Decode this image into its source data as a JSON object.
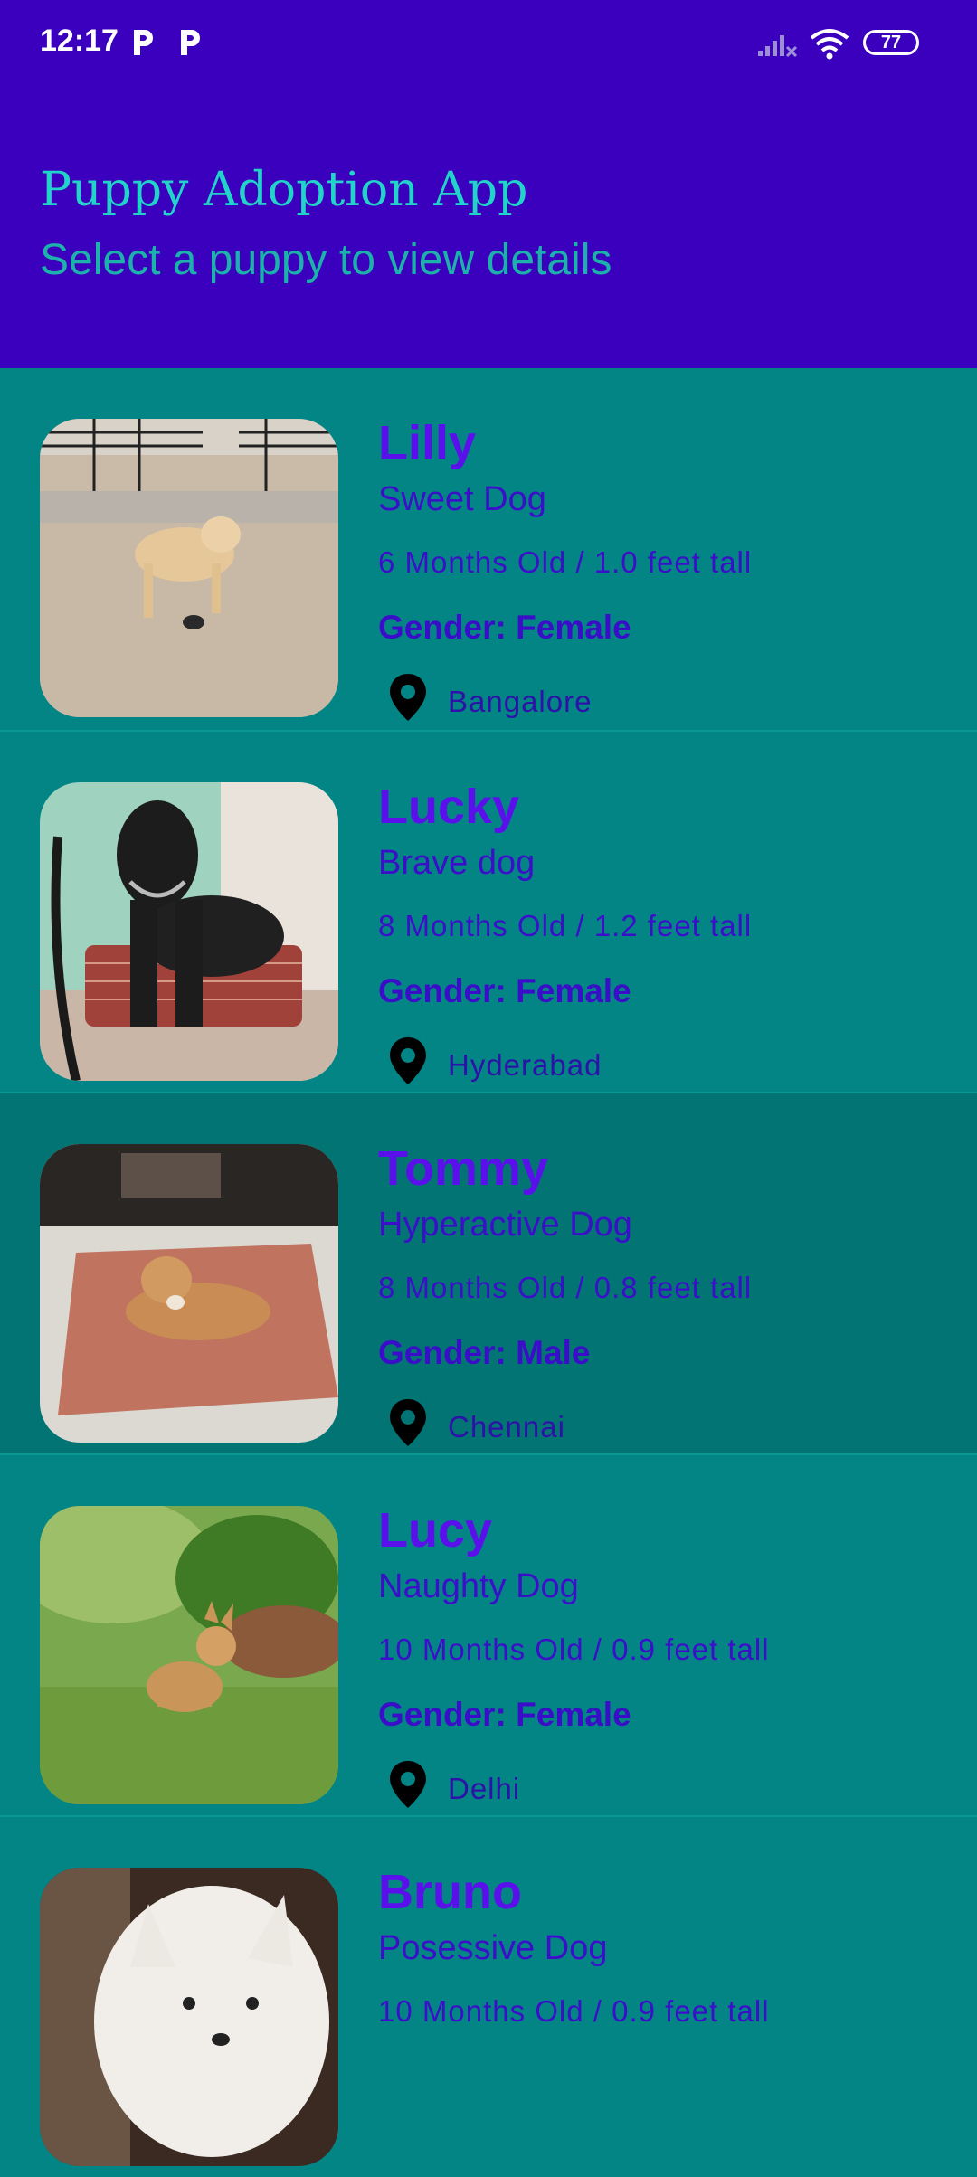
{
  "status_bar": {
    "time": "12:17",
    "battery": "77",
    "icons": [
      "p-notification-icon",
      "p-notification-icon",
      "signal-icon",
      "wifi-icon",
      "battery-icon"
    ]
  },
  "header": {
    "title": "Puppy Adoption App",
    "subtitle": "Select a puppy to view details"
  },
  "colors": {
    "header_bg": "#3a00bd",
    "list_bg": "#048585",
    "selected_bg": "#037474",
    "title": "#22d3c9",
    "name": "#5a10ea"
  },
  "puppies": [
    {
      "name": "Lilly",
      "temperament": "Sweet Dog",
      "age_height": "6 Months Old / 1.0 feet tall",
      "gender": "Gender: Female",
      "location": "Bangalore"
    },
    {
      "name": "Lucky",
      "temperament": "Brave dog",
      "age_height": "8 Months Old / 1.2 feet tall",
      "gender": "Gender: Female",
      "location": "Hyderabad"
    },
    {
      "name": "Tommy",
      "temperament": "Hyperactive Dog",
      "age_height": "8 Months Old / 0.8 feet tall",
      "gender": "Gender: Male",
      "location": "Chennai"
    },
    {
      "name": "Lucy",
      "temperament": "Naughty Dog",
      "age_height": "10 Months Old / 0.9 feet tall",
      "gender": "Gender: Female",
      "location": "Delhi"
    },
    {
      "name": "Bruno",
      "temperament": "Posessive Dog",
      "age_height": "10 Months Old / 0.9 feet tall",
      "gender": "",
      "location": ""
    }
  ]
}
